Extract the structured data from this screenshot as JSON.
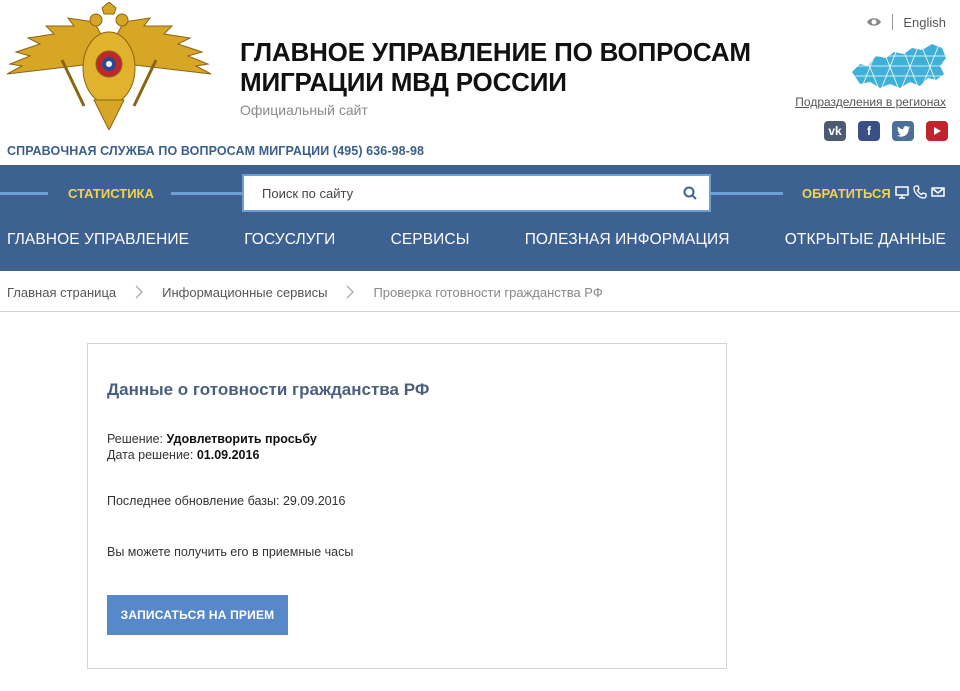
{
  "header": {
    "title_line1": "ГЛАВНОЕ УПРАВЛЕНИЕ ПО ВОПРОСАМ",
    "title_line2": "МИГРАЦИИ МВД РОССИИ",
    "subtitle": "Официальный сайт",
    "helpline": "СПРАВОЧНАЯ СЛУЖБА ПО ВОПРОСАМ МИГРАЦИИ (495) 636-98-98",
    "language_link": "English",
    "regions_link": "Подразделения в регионах",
    "social": [
      "vk-icon",
      "facebook-icon",
      "twitter-icon",
      "youtube-icon"
    ],
    "colors": {
      "nav_bg": "#3d6191",
      "accent_yellow": "#f2d44a",
      "button_blue": "#5788c9"
    }
  },
  "nav": {
    "statistics": "СТАТИСТИКА",
    "contact": "ОБРАТИТЬСЯ",
    "search_placeholder": "Поиск по сайту",
    "menu": [
      "ГЛАВНОЕ УПРАВЛЕНИЕ",
      "ГОСУСЛУГИ",
      "СЕРВИСЫ",
      "ПОЛЕЗНАЯ ИНФОРМАЦИЯ",
      "ОТКРЫТЫЕ ДАННЫЕ"
    ]
  },
  "breadcrumb": [
    "Главная страница",
    "Информационные сервисы",
    "Проверка готовности гражданства РФ"
  ],
  "card": {
    "title": "Данные о готовности гражданства РФ",
    "decision_label": "Решение:",
    "decision_value": "Удовлетворить просьбу",
    "date_label": "Дата решение:",
    "date_value": "01.09.2016",
    "last_update": "Последнее обновление базы: 29.09.2016",
    "pickup_note": "Вы можете получить его в приемные часы",
    "button": "ЗАПИСАТЬСЯ НА ПРИЕМ"
  }
}
